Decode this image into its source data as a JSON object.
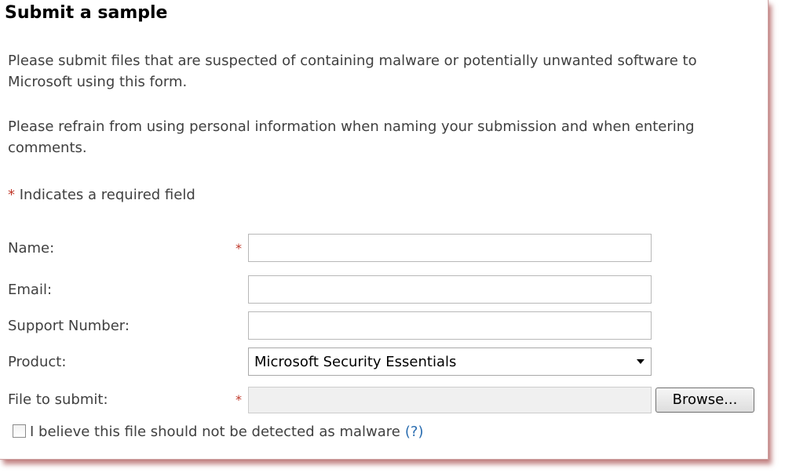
{
  "form": {
    "title": "Submit a sample",
    "intro_1": "Please submit files that are suspected of containing malware or potentially unwanted software to Microsoft using this form.",
    "intro_2": "Please refrain from using personal information when naming your submission and when entering comments.",
    "required_marker": "*",
    "required_note": " Indicates a required field"
  },
  "fields": {
    "name_label": "Name:",
    "name_value": "",
    "email_label": "Email:",
    "email_value": "",
    "support_label": "Support Number:",
    "support_value": "",
    "product_label": "Product:",
    "product_value": "Microsoft Security Essentials",
    "file_label": "File to submit:",
    "file_value": "",
    "browse_label": "Browse...",
    "checkbox_label": "I believe this file should not be detected as malware",
    "checkbox_checked": false,
    "help_link": "(?)"
  },
  "colors": {
    "required_star": "#c0392b",
    "help_link": "#2a6db0"
  }
}
